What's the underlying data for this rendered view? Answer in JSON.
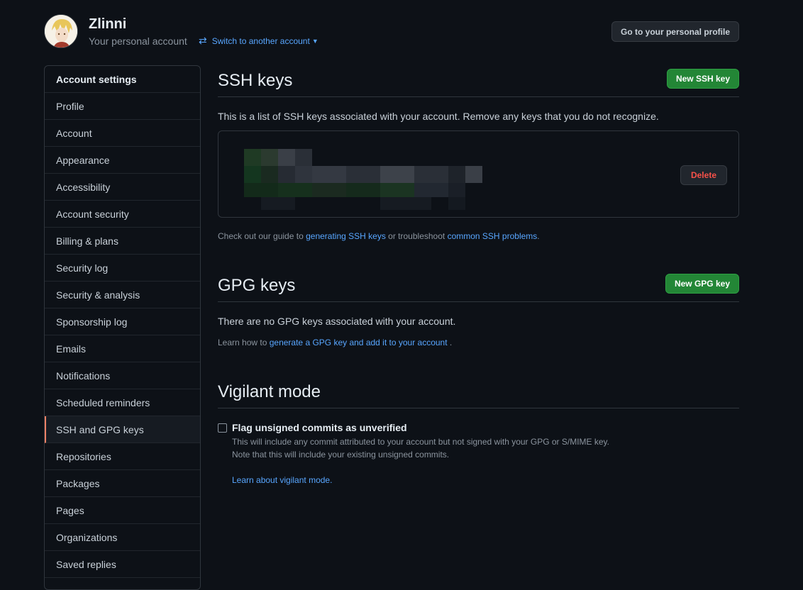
{
  "header": {
    "user_name": "Zlinni",
    "account_type": "Your personal account",
    "switch_label": "Switch to another account",
    "profile_button": "Go to your personal profile"
  },
  "sidebar": {
    "title": "Account settings",
    "items": [
      {
        "label": "Profile"
      },
      {
        "label": "Account"
      },
      {
        "label": "Appearance"
      },
      {
        "label": "Accessibility"
      },
      {
        "label": "Account security"
      },
      {
        "label": "Billing & plans"
      },
      {
        "label": "Security log"
      },
      {
        "label": "Security & analysis"
      },
      {
        "label": "Sponsorship log"
      },
      {
        "label": "Emails"
      },
      {
        "label": "Notifications"
      },
      {
        "label": "Scheduled reminders"
      },
      {
        "label": "SSH and GPG keys",
        "active": true
      },
      {
        "label": "Repositories"
      },
      {
        "label": "Packages"
      },
      {
        "label": "Pages"
      },
      {
        "label": "Organizations"
      },
      {
        "label": "Saved replies"
      }
    ]
  },
  "ssh": {
    "title": "SSH keys",
    "new_button": "New SSH key",
    "description": "This is a list of SSH keys associated with your account. Remove any keys that you do not recognize.",
    "delete_button": "Delete",
    "guide_prefix": "Check out our guide to",
    "guide_link": "generating SSH keys",
    "guide_middle": "or troubleshoot",
    "guide_link2": "common SSH problems",
    "guide_suffix": "."
  },
  "gpg": {
    "title": "GPG keys",
    "new_button": "New GPG key",
    "empty_text": "There are no GPG keys associated with your account.",
    "learn_prefix": "Learn how to",
    "learn_link": "generate a GPG key and add it to your account",
    "learn_suffix": "."
  },
  "vigilant": {
    "title": "Vigilant mode",
    "checkbox_label": "Flag unsigned commits as unverified",
    "help_line1": "This will include any commit attributed to your account but not signed with your GPG or S/MIME key.",
    "help_line2": "Note that this will include your existing unsigned commits.",
    "learn_link": "Learn about vigilant mode."
  },
  "colors": {
    "background": "#0d1117",
    "accent_link": "#58a6ff",
    "primary_button": "#238636",
    "danger": "#f85149",
    "active_indicator": "#f78166"
  }
}
